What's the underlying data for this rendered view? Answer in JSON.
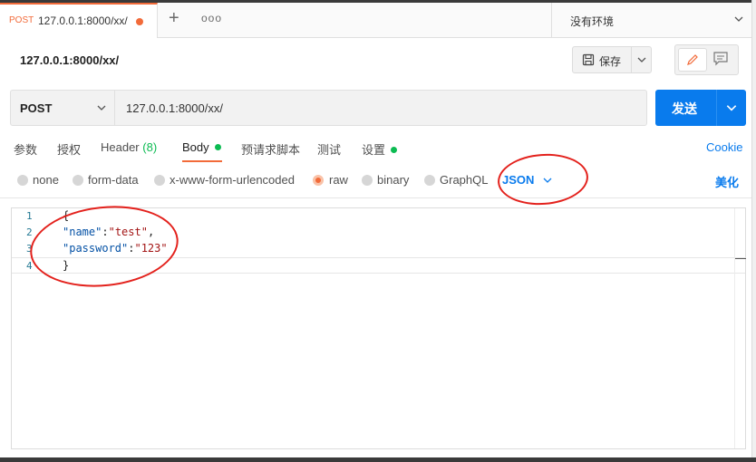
{
  "tab": {
    "method": "POST",
    "url": "127.0.0.1:8000/xx/"
  },
  "environment": {
    "label": "没有环境"
  },
  "request_title": "127.0.0.1:8000/xx/",
  "toolbar": {
    "save_label": "保存"
  },
  "request": {
    "method": "POST",
    "url": "127.0.0.1:8000/xx/",
    "send_label": "发送"
  },
  "request_tabs": {
    "params": "参数",
    "auth": "授权",
    "headers": "Header",
    "headers_count": "(8)",
    "body": "Body",
    "prerequest": "预请求脚本",
    "tests": "测试",
    "settings": "设置",
    "cookie": "Cookie"
  },
  "body_options": {
    "none": "none",
    "form_data": "form-data",
    "urlencoded": "x-www-form-urlencoded",
    "raw": "raw",
    "binary": "binary",
    "graphql": "GraphQL",
    "format": "JSON",
    "beautify": "美化",
    "selected": "raw"
  },
  "editor": {
    "line_numbers": [
      "1",
      "2",
      "3",
      "4"
    ],
    "line1": "{",
    "line2_key": "\"name\"",
    "line2_sep": ":",
    "line2_val": "\"test\"",
    "line2_end": ",",
    "line3_key": "\"password\"",
    "line3_sep": ":",
    "line3_val": "\"123\"",
    "line4": "}"
  },
  "colors": {
    "accent": "#097bed",
    "orange": "#f26b3a",
    "green": "#0cbb52",
    "annotation": "#e3211c"
  }
}
